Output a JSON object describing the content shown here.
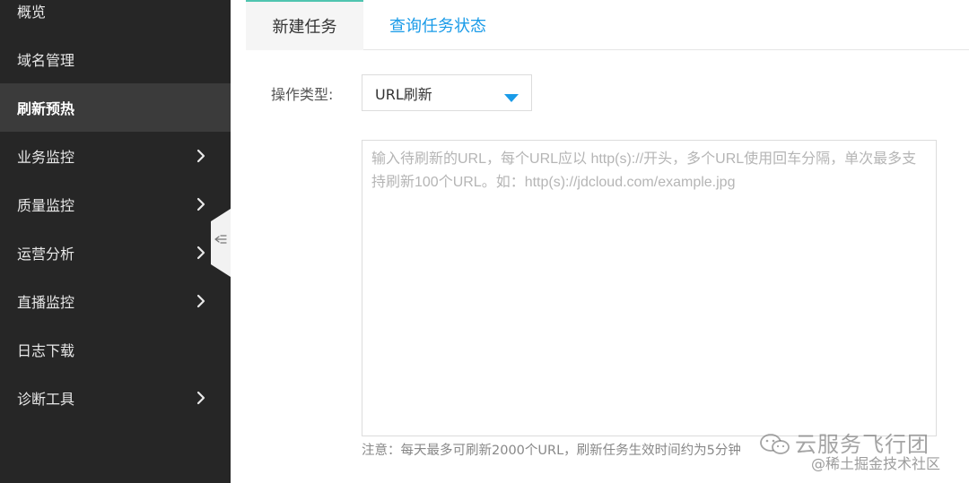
{
  "sidebar": {
    "items": [
      {
        "label": "概览",
        "has_submenu": false,
        "active": false
      },
      {
        "label": "域名管理",
        "has_submenu": false,
        "active": false
      },
      {
        "label": "刷新预热",
        "has_submenu": false,
        "active": true
      },
      {
        "label": "业务监控",
        "has_submenu": true,
        "active": false
      },
      {
        "label": "质量监控",
        "has_submenu": true,
        "active": false
      },
      {
        "label": "运营分析",
        "has_submenu": true,
        "active": false
      },
      {
        "label": "直播监控",
        "has_submenu": true,
        "active": false
      },
      {
        "label": "日志下载",
        "has_submenu": false,
        "active": false
      },
      {
        "label": "诊断工具",
        "has_submenu": true,
        "active": false
      }
    ],
    "collapse_icon": "collapse-left-icon"
  },
  "tabs": [
    {
      "label": "新建任务",
      "active": true
    },
    {
      "label": "查询任务状态",
      "active": false
    }
  ],
  "form": {
    "operation_label": "操作类型:",
    "operation_value": "URL刷新",
    "url_placeholder": "输入待刷新的URL，每个URL应以 http(s)://开头，多个URL使用回车分隔，单次最多支持刷新100个URL。如：http(s)://jdcloud.com/example.jpg",
    "url_value": "",
    "note": "注意：每天最多可刷新2000个URL，刷新任务生效时间约为5分钟"
  },
  "watermark": {
    "line1": "云服务飞行团",
    "line2": "@稀土掘金技术社区"
  },
  "colors": {
    "sidebar_bg": "#262626",
    "sidebar_active_bg": "#3b3b3b",
    "accent_blue": "#1a9be8",
    "tab_active_border": "#4fc4b0",
    "caret": "#1a9be8"
  }
}
